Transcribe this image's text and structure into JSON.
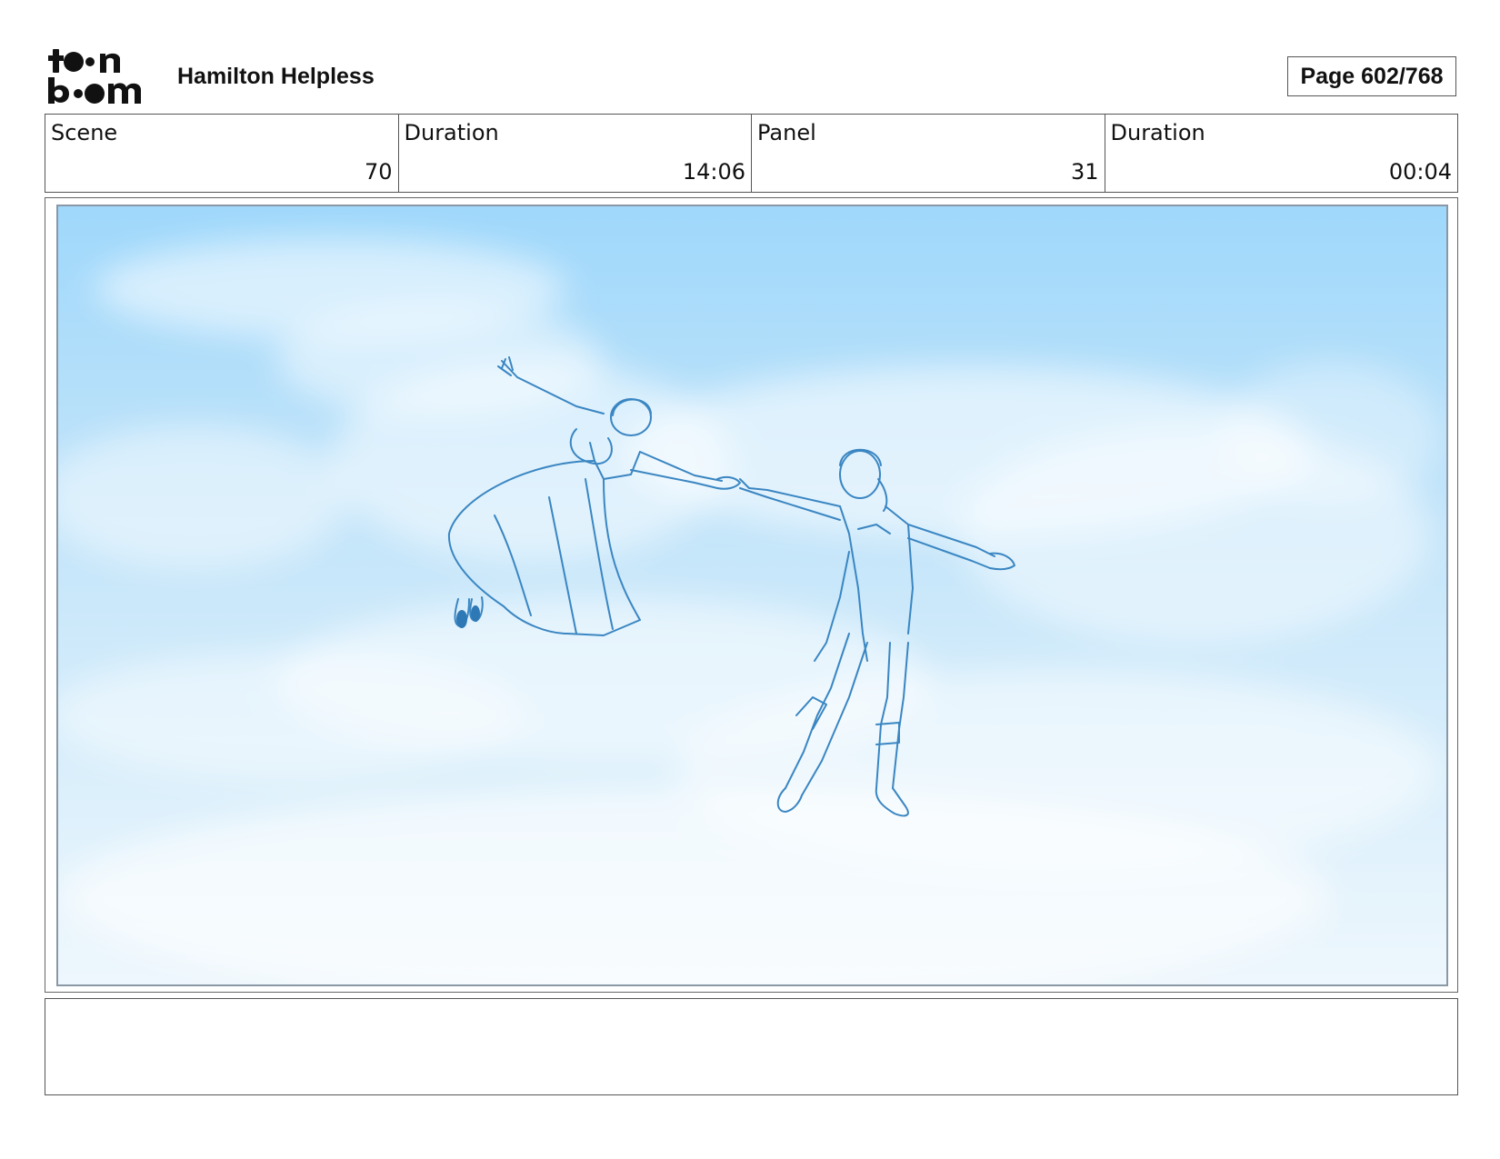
{
  "header": {
    "logo_text": "toon boom",
    "title": "Hamilton Helpless",
    "page_label": "Page 602/768"
  },
  "info": [
    {
      "label": "Scene",
      "value": "70"
    },
    {
      "label": "Duration",
      "value": "14:06"
    },
    {
      "label": "Panel",
      "value": "31"
    },
    {
      "label": "Duration",
      "value": "00:04"
    }
  ],
  "panel": {
    "image_subject": "storyboard sketch of two figures flying in a cloudy sky",
    "sky_color": "#a6dafb",
    "line_color": "#3a86c2"
  },
  "notes": {
    "text": ""
  }
}
